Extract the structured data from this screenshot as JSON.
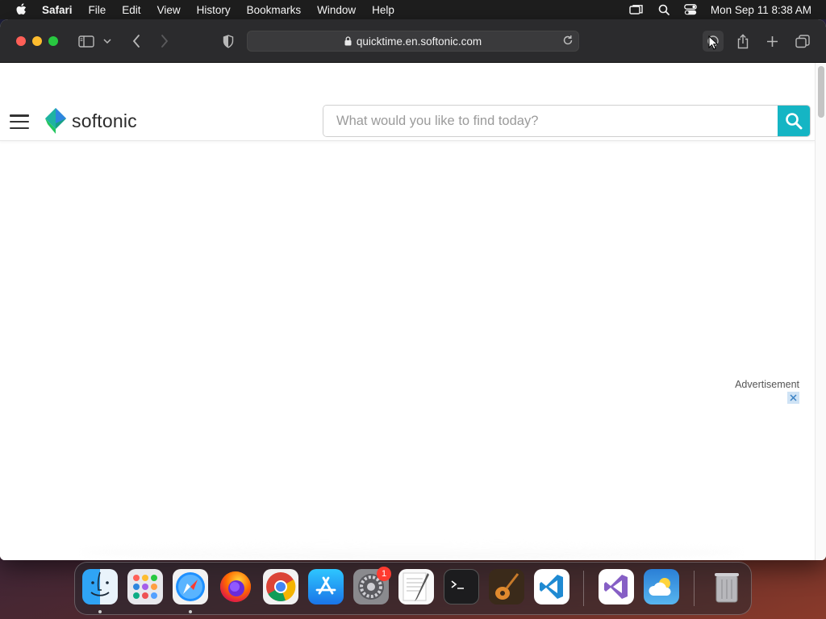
{
  "menubar": {
    "app_name": "Safari",
    "items": [
      "File",
      "Edit",
      "View",
      "History",
      "Bookmarks",
      "Window",
      "Help"
    ],
    "clock": "Mon Sep 11  8:38 AM",
    "status_icons": [
      "screen-mirroring-icon",
      "spotlight-search-icon",
      "control-center-icon"
    ]
  },
  "browser": {
    "url": "quicktime.en.softonic.com",
    "traffic_lights": {
      "close": "#ff5f57",
      "minimize": "#febc2e",
      "zoom": "#28c840"
    }
  },
  "site": {
    "logo_text": "softonic",
    "search_placeholder": "What would you like to find today?",
    "search_button_color": "#15b5c4",
    "ad_label": "Advertisement"
  },
  "dock": {
    "apps": [
      {
        "name": "Finder",
        "running": true
      },
      {
        "name": "Launchpad",
        "running": false
      },
      {
        "name": "Safari",
        "running": true
      },
      {
        "name": "Firefox",
        "running": false
      },
      {
        "name": "Chrome",
        "running": false
      },
      {
        "name": "App Store",
        "running": false
      },
      {
        "name": "System Preferences",
        "running": false,
        "badge": "1"
      },
      {
        "name": "TextEdit",
        "running": false
      },
      {
        "name": "Terminal",
        "running": false
      },
      {
        "name": "GarageBand",
        "running": false
      },
      {
        "name": "Visual Studio Code",
        "running": false
      },
      {
        "name": "Visual Studio",
        "running": false
      },
      {
        "name": "Weather",
        "running": false
      },
      {
        "name": "Trash",
        "running": false
      }
    ]
  }
}
